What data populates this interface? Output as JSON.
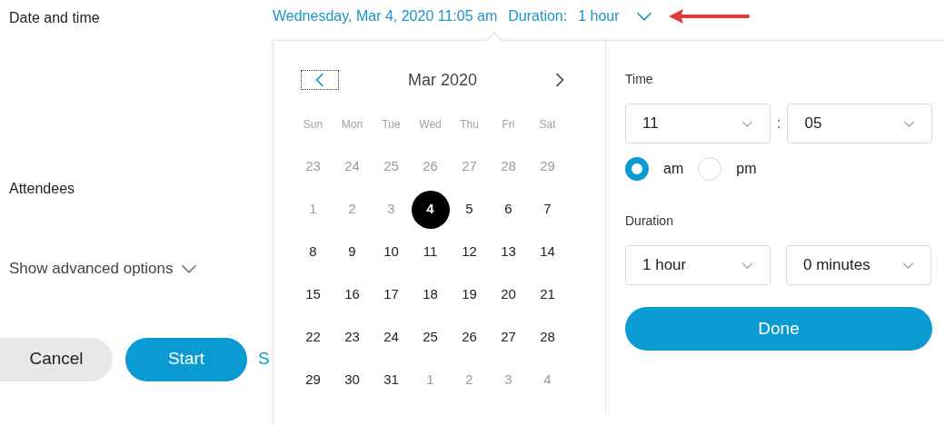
{
  "form": {
    "labels": [
      {
        "text": "Date and time"
      },
      {
        "text": "Attendees"
      }
    ],
    "advanced_toggle": {
      "label": "Show advanced options",
      "expanded": false
    },
    "buttons": [
      {
        "label": "Cancel",
        "kind": "secondary"
      },
      {
        "label": "Start",
        "kind": "primary"
      },
      {
        "label": "S",
        "kind": "link"
      }
    ]
  },
  "summary": {
    "datetime": "Wednesday, Mar 4, 2020 11:05 am",
    "duration_label": "Duration:",
    "duration": "1 hour",
    "expanded": true
  },
  "calendar": {
    "month": "Mar 2020",
    "prev_focused": true,
    "weekdays": [
      "Sun",
      "Mon",
      "Tue",
      "Wed",
      "Thu",
      "Fri",
      "Sat"
    ],
    "weeks": [
      [
        {
          "day": "23",
          "disabled": true,
          "selected": false
        },
        {
          "day": "24",
          "disabled": true,
          "selected": false
        },
        {
          "day": "25",
          "disabled": true,
          "selected": false
        },
        {
          "day": "26",
          "disabled": true,
          "selected": false
        },
        {
          "day": "27",
          "disabled": true,
          "selected": false
        },
        {
          "day": "28",
          "disabled": true,
          "selected": false
        },
        {
          "day": "29",
          "disabled": true,
          "selected": false
        }
      ],
      [
        {
          "day": "1",
          "disabled": true,
          "selected": false
        },
        {
          "day": "2",
          "disabled": true,
          "selected": false
        },
        {
          "day": "3",
          "disabled": true,
          "selected": false
        },
        {
          "day": "4",
          "disabled": false,
          "selected": true
        },
        {
          "day": "5",
          "disabled": false,
          "selected": false
        },
        {
          "day": "6",
          "disabled": false,
          "selected": false
        },
        {
          "day": "7",
          "disabled": false,
          "selected": false
        }
      ],
      [
        {
          "day": "8",
          "disabled": false,
          "selected": false
        },
        {
          "day": "9",
          "disabled": false,
          "selected": false
        },
        {
          "day": "10",
          "disabled": false,
          "selected": false
        },
        {
          "day": "11",
          "disabled": false,
          "selected": false
        },
        {
          "day": "12",
          "disabled": false,
          "selected": false
        },
        {
          "day": "13",
          "disabled": false,
          "selected": false
        },
        {
          "day": "14",
          "disabled": false,
          "selected": false
        }
      ],
      [
        {
          "day": "15",
          "disabled": false,
          "selected": false
        },
        {
          "day": "16",
          "disabled": false,
          "selected": false
        },
        {
          "day": "17",
          "disabled": false,
          "selected": false
        },
        {
          "day": "18",
          "disabled": false,
          "selected": false
        },
        {
          "day": "19",
          "disabled": false,
          "selected": false
        },
        {
          "day": "20",
          "disabled": false,
          "selected": false
        },
        {
          "day": "21",
          "disabled": false,
          "selected": false
        }
      ],
      [
        {
          "day": "22",
          "disabled": false,
          "selected": false
        },
        {
          "day": "23",
          "disabled": false,
          "selected": false
        },
        {
          "day": "24",
          "disabled": false,
          "selected": false
        },
        {
          "day": "25",
          "disabled": false,
          "selected": false
        },
        {
          "day": "26",
          "disabled": false,
          "selected": false
        },
        {
          "day": "27",
          "disabled": false,
          "selected": false
        },
        {
          "day": "28",
          "disabled": false,
          "selected": false
        }
      ],
      [
        {
          "day": "29",
          "disabled": false,
          "selected": false
        },
        {
          "day": "30",
          "disabled": false,
          "selected": false
        },
        {
          "day": "31",
          "disabled": false,
          "selected": false
        },
        {
          "day": "1",
          "disabled": true,
          "selected": false
        },
        {
          "day": "2",
          "disabled": true,
          "selected": false
        },
        {
          "day": "3",
          "disabled": true,
          "selected": false
        },
        {
          "day": "4",
          "disabled": true,
          "selected": false
        }
      ]
    ]
  },
  "time": {
    "label": "Time",
    "hour": "11",
    "separator": ":",
    "minute": "05",
    "periods": [
      {
        "label": "am",
        "selected": true
      },
      {
        "label": "pm",
        "selected": false
      }
    ]
  },
  "duration": {
    "label": "Duration",
    "hours": "1 hour",
    "minutes": "0 minutes"
  },
  "done_button": "Done"
}
